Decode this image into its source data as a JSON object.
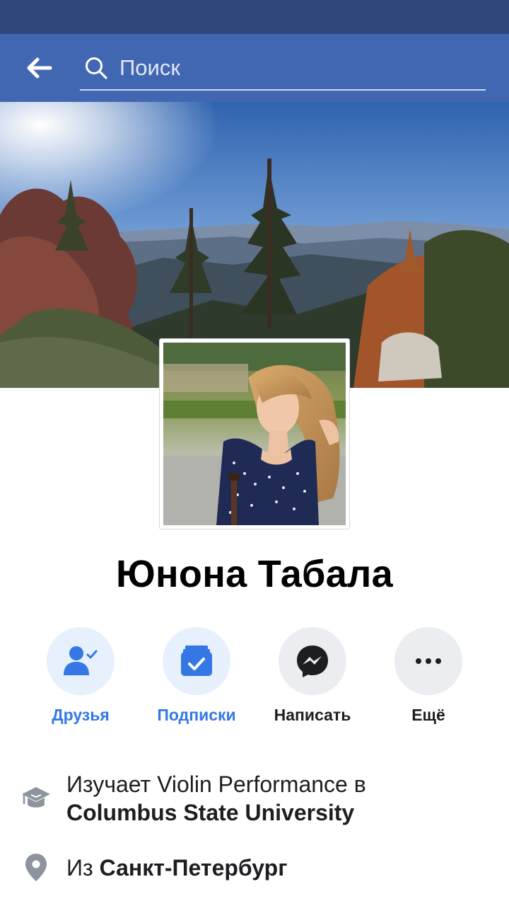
{
  "header": {
    "search_placeholder": "Поиск",
    "bar_color": "#4267b2",
    "status_color": "#30477c"
  },
  "profile": {
    "name": "Юнона Табала"
  },
  "actions": [
    {
      "label": "Друзья",
      "icon": "friends-check-icon",
      "active": true
    },
    {
      "label": "Подписки",
      "icon": "following-icon",
      "active": true
    },
    {
      "label": "Написать",
      "icon": "messenger-icon",
      "active": false
    },
    {
      "label": "Ещё",
      "icon": "more-dots-icon",
      "active": false
    }
  ],
  "info": {
    "education_prefix": "Изучает Violin Performance в",
    "education_school": "Columbus State University",
    "hometown_prefix": "Из",
    "hometown_city": "Санкт-Петербург"
  },
  "colors": {
    "accent": "#3578e5",
    "icon_gray": "#8d949e"
  }
}
